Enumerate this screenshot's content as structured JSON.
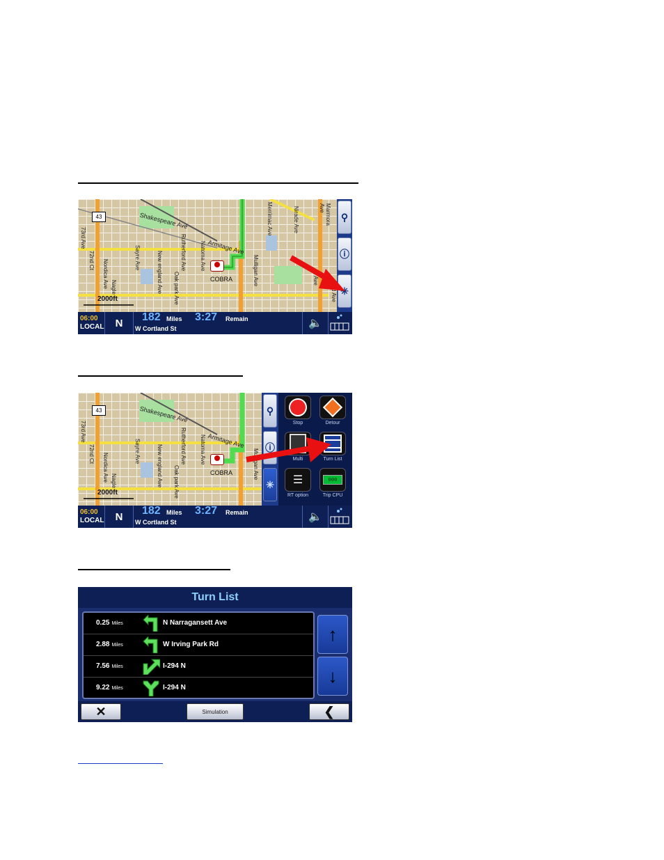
{
  "map": {
    "route_shield": "43",
    "streets": {
      "shakespeare": "Shakespeare Ave",
      "armitage": "Armitage Ave",
      "rutherford": "Rutherford Ave",
      "natoma": "Natoma Ave",
      "oak_park": "Oak park Ave",
      "new_england": "New england Ave",
      "sayre": "Sayre Ave",
      "nordica": "Nordica Ave",
      "nagle": "Nagle",
      "merrimac": "Merrimac Ave",
      "mulligan": "Mulligan Ave",
      "neva": "Neva Ave",
      "narragansett": "Nirade Ave",
      "marmora": "Marmora Ave",
      "central": "d Ave",
      "seventy_second": "72nd Ct",
      "seventy_third": "73rd Ave",
      "austin": "n Ave"
    },
    "poi_label": "COBRA",
    "scale_label": "2000ft"
  },
  "status": {
    "time": "06:00",
    "time_label": "LOCAL",
    "heading": "N",
    "distance": "182",
    "distance_unit": "Miles",
    "eta": "3:27",
    "eta_label": "Remain",
    "street": "W Cortland St"
  },
  "menu": {
    "items": [
      {
        "label": "Stop"
      },
      {
        "label": "Detour"
      },
      {
        "label": "Multi"
      },
      {
        "label": "Turn List"
      },
      {
        "label": "RT option"
      },
      {
        "label": "Trip CPU"
      }
    ],
    "cpu_text": "000"
  },
  "turn_list": {
    "title": "Turn List",
    "rows": [
      {
        "dist": "0.25",
        "unit": "Miles",
        "street": "N Narragansett Ave",
        "maneuver": "turn-left"
      },
      {
        "dist": "2.88",
        "unit": "Miles",
        "street": "W Irving Park Rd",
        "maneuver": "turn-left"
      },
      {
        "dist": "7.56",
        "unit": "Miles",
        "street": "I-294 N",
        "maneuver": "keep-right"
      },
      {
        "dist": "9.22",
        "unit": "Miles",
        "street": "I-294 N",
        "maneuver": "fork"
      }
    ],
    "simulation_label": "Simulation"
  },
  "colors": {
    "nav_blue": "#0d1f55",
    "route_green": "#4fdc4f",
    "arrow_red": "#e81010",
    "time_yellow": "#f0c030"
  }
}
